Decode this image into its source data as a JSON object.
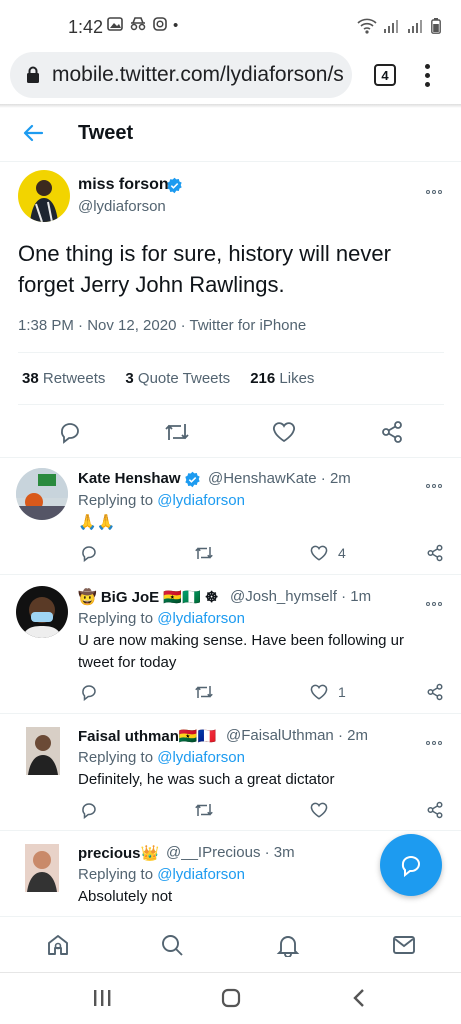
{
  "status_bar": {
    "time": "1:42",
    "dot": "•"
  },
  "browser": {
    "url": "mobile.twitter.com/lydiaforson/s",
    "tab_count": "4"
  },
  "header": {
    "title": "Tweet"
  },
  "tweet": {
    "name": "miss forson",
    "handle": "@lydiaforson",
    "text": "One thing is for sure, history will never forget Jerry John Rawlings.",
    "meta": "1:38 PM · Nov 12, 2020 · Twitter for iPhone",
    "stats": [
      {
        "count": "38",
        "label": "Retweets"
      },
      {
        "count": "3",
        "label": "Quote Tweets"
      },
      {
        "count": "216",
        "label": "Likes"
      }
    ]
  },
  "replies": [
    {
      "name": "Kate Henshaw",
      "handle": "@HenshawKate",
      "time": "· 2m",
      "replying_prefix": "Replying to",
      "replying_to": "@lydiaforson",
      "text": "🙏🙏",
      "likes": "4"
    },
    {
      "name": "🤠 BiG JoE 🇬🇭🇳🇬 ☸",
      "handle": "@Josh_hymself",
      "time": "· 1m",
      "replying_prefix": "Replying to",
      "replying_to": "@lydiaforson",
      "text": "U are now making sense. Have been following ur tweet for today",
      "likes": "1"
    },
    {
      "name": "Faisal uthman🇬🇭🇫🇷",
      "handle": "@FaisalUthman",
      "time": "· 2m",
      "replying_prefix": "Replying to",
      "replying_to": "@lydiaforson",
      "text": "Definitely, he was such a great dictator",
      "likes": ""
    },
    {
      "name": "precious👑",
      "handle": "@__IPrecious",
      "time": "· 3m",
      "replying_prefix": "Replying to",
      "replying_to": "@lydiaforson",
      "text": "Absolutely not",
      "likes": ""
    }
  ],
  "colors": {
    "accent": "#1d9bf0",
    "text": "#0f1419",
    "muted": "#536471"
  },
  "icons": [
    "back-arrow-icon",
    "verified-icon",
    "reply-icon",
    "retweet-icon",
    "like-icon",
    "share-icon",
    "compose-message-icon",
    "home-icon",
    "search-icon",
    "notifications-icon",
    "messages-icon"
  ]
}
